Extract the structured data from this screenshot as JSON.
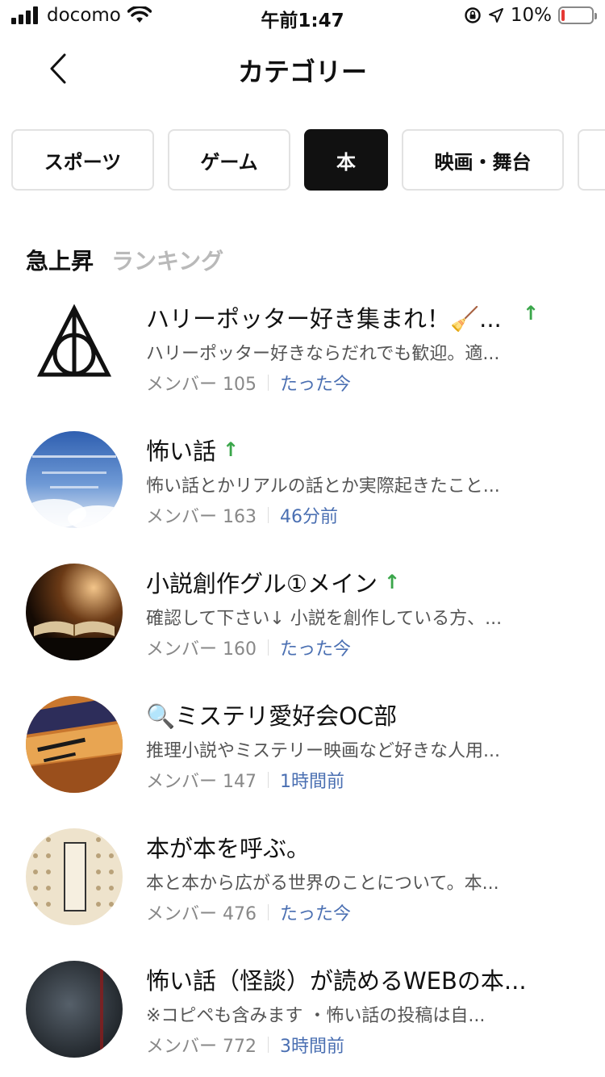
{
  "status_bar": {
    "carrier": "docomo",
    "time": "午前1:47",
    "battery": "10%",
    "battery_level": 0.1,
    "icons": [
      "signal-icon",
      "wifi-icon",
      "orientation-lock-icon",
      "location-icon",
      "battery-icon"
    ]
  },
  "header": {
    "title": "カテゴリー",
    "back_icon": "chevron-left-icon"
  },
  "categories": [
    "スポーツ",
    "ゲーム",
    "本",
    "映画・舞台"
  ],
  "selected_category": "本",
  "section_tabs": {
    "active": "急上昇",
    "inactive": "ランキング"
  },
  "items": [
    {
      "title": "ハリーポッター好き集まれ！🧹...",
      "description": "ハリーポッター好きならだれでも歓迎。適...",
      "member_label": "メンバー 105",
      "time": "たった今",
      "trending": true
    },
    {
      "title": "怖い話",
      "description": "怖い話とかリアルの話とか実際起きたこと...",
      "member_label": "メンバー 163",
      "time": "46分前",
      "trending": true
    },
    {
      "title": "小説創作グル①メイン",
      "description": "確認して下さい↓ 小説を創作している方、...",
      "member_label": "メンバー 160",
      "time": "たった今",
      "trending": true
    },
    {
      "title": "🔍ミステリ愛好会OC部",
      "description": "推理小説やミステリー映画など好きな人用...",
      "member_label": "メンバー 147",
      "time": "1時間前",
      "trending": false
    },
    {
      "title": "本が本を呼ぶ。",
      "description": "本と本から広がる世界のことについて。本...",
      "member_label": "メンバー 476",
      "time": "たった今",
      "trending": false
    },
    {
      "title": "怖い話（怪談）が読めるWEBの本...",
      "description": "※コピペも含みます ・怖い話の投稿は自...",
      "member_label": "メンバー 772",
      "time": "3時間前",
      "trending": false
    }
  ],
  "trend_icon": "up-arrow-icon",
  "colors": {
    "accent_time": "#4a6fb2",
    "trend": "#3aa64a",
    "active_chip": "#111111"
  }
}
